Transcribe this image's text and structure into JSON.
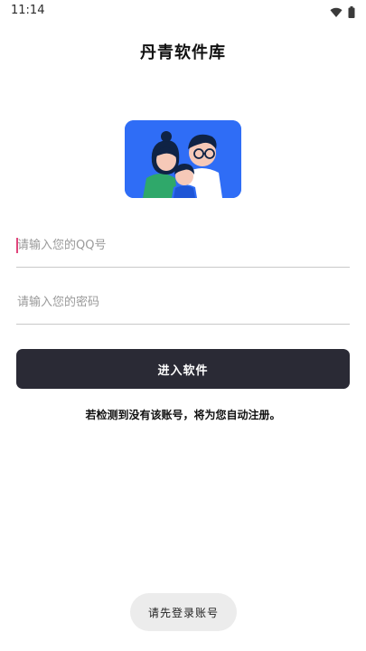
{
  "status_bar": {
    "time": "11:14",
    "icons": [
      "wifi-icon",
      "battery-icon"
    ]
  },
  "app": {
    "title": "丹青软件库"
  },
  "hero": {
    "image": "family-illustration",
    "colors": {
      "background": "#2f6df6",
      "hair": "#0f2345",
      "skin": "#f6c9b8",
      "shirt_green": "#2fa86a",
      "shirt_white": "#ffffff"
    }
  },
  "form": {
    "qq_placeholder": "请输入您的QQ号",
    "password_placeholder": "请输入您的密码",
    "submit_label": "进入软件"
  },
  "hint": "若检测到没有该账号，将为您自动注册。",
  "toast": "请先登录账号",
  "colors": {
    "button_bg": "#2a2a35",
    "cursor": "#e0457b",
    "toast_bg": "#ececec"
  }
}
